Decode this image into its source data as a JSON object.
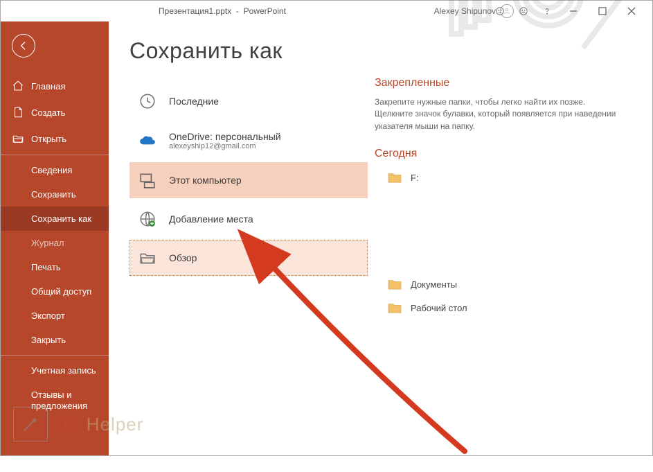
{
  "titlebar": {
    "filename": "Презентация1.pptx",
    "sep": "-",
    "app": "PowerPoint",
    "user": "Alexey Shipunov"
  },
  "sidebar": {
    "home": "Главная",
    "new": "Создать",
    "open": "Открыть",
    "info": "Сведения",
    "save": "Сохранить",
    "saveas": "Сохранить как",
    "history": "Журнал",
    "print": "Печать",
    "share": "Общий доступ",
    "export": "Экспорт",
    "close": "Закрыть",
    "account": "Учетная запись",
    "feedback": "Отзывы и предложения"
  },
  "page": {
    "title": "Сохранить как"
  },
  "locations": {
    "recent": "Последние",
    "onedrive": "OneDrive: персональный",
    "onedrive_sub": "alexeyship12@gmail.com",
    "thispc": "Этот компьютер",
    "addplace": "Добавление места",
    "browse": "Обзор"
  },
  "right": {
    "pinned_title": "Закрепленные",
    "pinned_desc": "Закрепите нужные папки, чтобы легко найти их позже. Щелкните значок булавки, который появляется при наведении указателя мыши на папку.",
    "today_title": "Сегодня",
    "folder_f": "F:",
    "folder_docs": "Документы",
    "folder_desktop": "Рабочий стол"
  },
  "watermark": {
    "text_os": "OS",
    "text_helper": " Helper"
  }
}
